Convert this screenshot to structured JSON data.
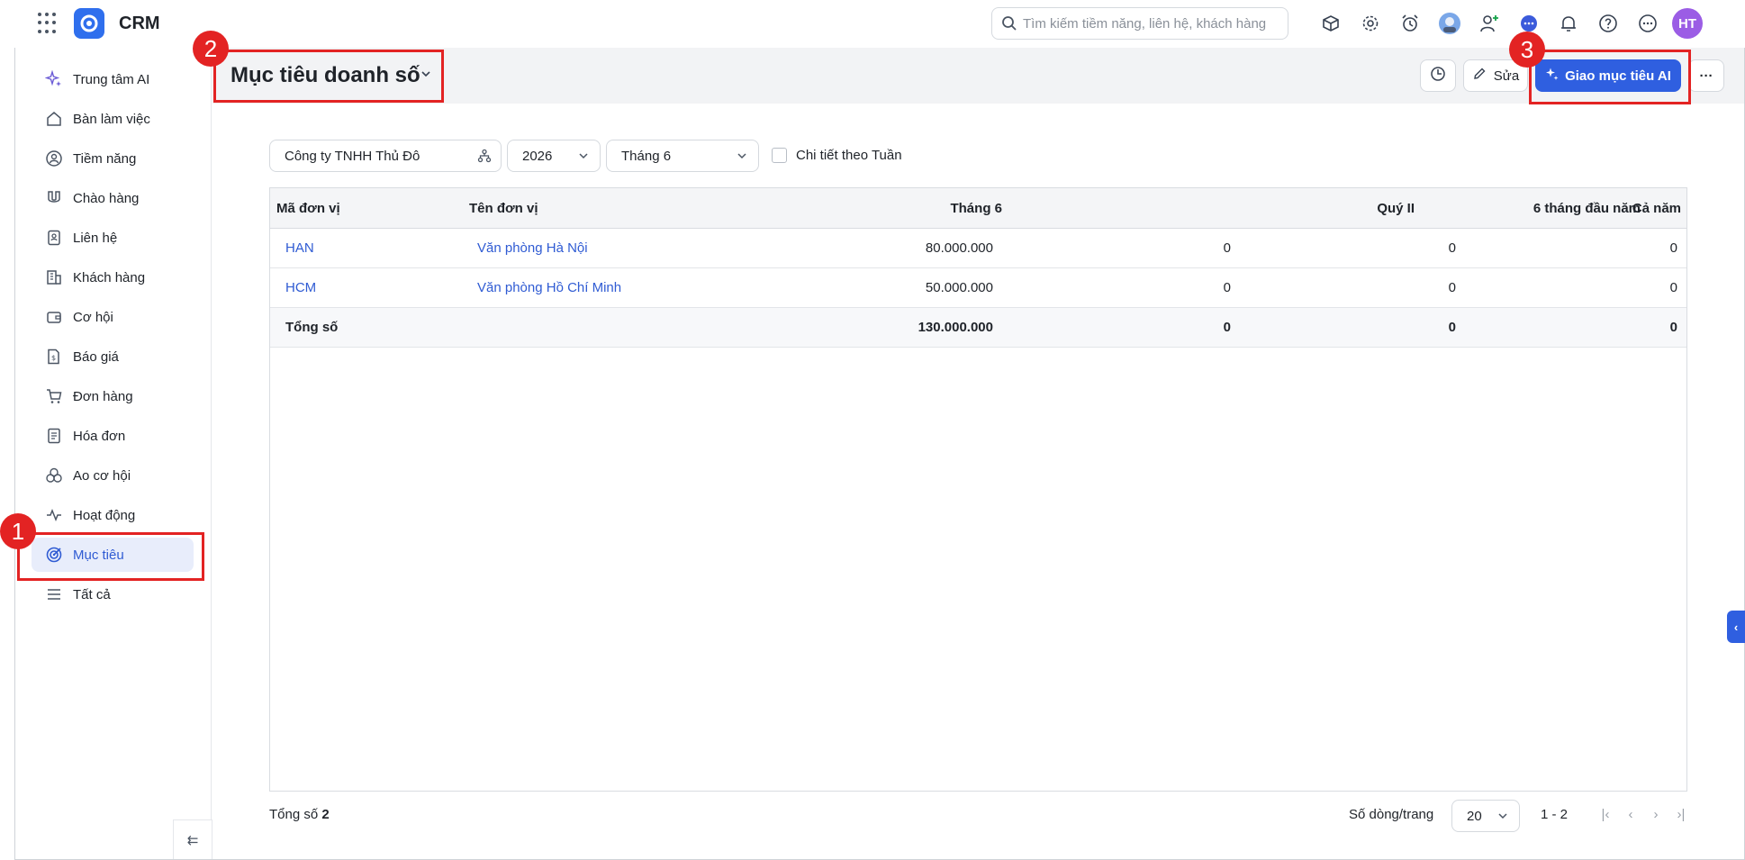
{
  "app": {
    "title": "CRM"
  },
  "search": {
    "placeholder": "Tìm kiếm tiềm năng, liên hệ, khách hàng",
    "value": ""
  },
  "topbar": {
    "icons": [
      "package-search-icon",
      "settings-icon",
      "alarm-icon",
      "assistant-avatar",
      "add-user-icon",
      "chat-icon",
      "bell-icon",
      "help-icon",
      "more-icon"
    ],
    "avatar_initials": "HT"
  },
  "sidebar": {
    "items": [
      {
        "label": "Trung tâm AI",
        "icon": "sparkle-icon"
      },
      {
        "label": "Bàn làm việc",
        "icon": "home-icon"
      },
      {
        "label": "Tiềm năng",
        "icon": "target-user-icon"
      },
      {
        "label": "Chào hàng",
        "icon": "magnet-icon"
      },
      {
        "label": "Liên hệ",
        "icon": "contact-book-icon"
      },
      {
        "label": "Khách hàng",
        "icon": "building-icon"
      },
      {
        "label": "Cơ hội",
        "icon": "wallet-icon"
      },
      {
        "label": "Báo giá",
        "icon": "quote-icon"
      },
      {
        "label": "Đơn hàng",
        "icon": "cart-icon"
      },
      {
        "label": "Hóa đơn",
        "icon": "invoice-icon"
      },
      {
        "label": "Ao cơ hội",
        "icon": "pool-icon"
      },
      {
        "label": "Hoạt động",
        "icon": "activity-icon"
      },
      {
        "label": "Mục tiêu",
        "icon": "target-icon",
        "active": true
      },
      {
        "label": "Tất cả",
        "icon": "menu-icon"
      }
    ],
    "collapse_label": "⇇"
  },
  "header": {
    "title": "Mục tiêu doanh số",
    "edit_label": "Sửa",
    "ai_button_label": "Giao mục tiêu AI",
    "more_label": "···"
  },
  "filters": {
    "company": "Công ty TNHH Thủ Đô",
    "year": "2026",
    "month": "Tháng 6",
    "weekly_detail_label": "Chi tiết theo Tuần",
    "weekly_detail_checked": false
  },
  "table": {
    "columns": [
      "Mã đơn vị",
      "Tên đơn vị",
      "Tháng 6",
      "Quý II",
      "6 tháng đầu năm",
      "Cả năm"
    ],
    "rows": [
      {
        "code": "HAN",
        "name": "Văn phòng Hà Nội",
        "month": "80.000.000",
        "quarter": "0",
        "half": "0",
        "year": "0"
      },
      {
        "code": "HCM",
        "name": "Văn phòng Hồ Chí Minh",
        "month": "50.000.000",
        "quarter": "0",
        "half": "0",
        "year": "0"
      }
    ],
    "total": {
      "label": "Tổng số",
      "month": "130.000.000",
      "quarter": "0",
      "half": "0",
      "year": "0"
    }
  },
  "footer": {
    "total_label": "Tổng số",
    "total_count": "2",
    "rows_per_page_label": "Số dòng/trang",
    "rows_per_page": "20",
    "range": "1 - 2"
  },
  "annotations": [
    "1",
    "2",
    "3"
  ],
  "colors": {
    "accent": "#2f5fe0",
    "annotation": "#e32323",
    "active_bg": "#e8edfb"
  }
}
